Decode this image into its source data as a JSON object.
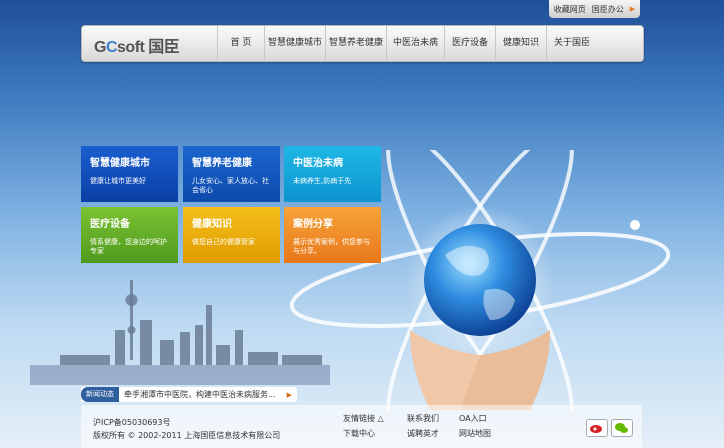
{
  "topbar": {
    "items": [
      "收藏网页",
      "国臣办公"
    ]
  },
  "nav": {
    "logo_prefix": "G",
    "logo_c": "C",
    "logo_suffix": "soft 国臣",
    "items": [
      "首 页",
      "智慧健康城市",
      "智慧养老健康",
      "中医治未病",
      "医疗设备",
      "健康知识",
      "关于国臣"
    ]
  },
  "tiles": [
    {
      "title": "智慧健康城市",
      "desc": "健康让城市更美好"
    },
    {
      "title": "智慧养老健康",
      "desc": "儿女安心、家人放心、社会省心"
    },
    {
      "title": "中医治未病",
      "desc": "未病养生,防病于先"
    },
    {
      "title": "医疗设备",
      "desc": "情系健康，您身边的呵护专家"
    },
    {
      "title": "健康知识",
      "desc": "做您自己的健康管家"
    },
    {
      "title": "案例分享",
      "desc": "展示优秀案例，供您参与与分享。"
    }
  ],
  "news": {
    "label": "新闻动态",
    "text": "牵手湘潭市中医院，构建中医治未病服务..."
  },
  "footer": {
    "icp": "沪ICP备05030693号",
    "copyright": "版权所有 © 2002-2011 上海国臣信息技术有限公司",
    "links": [
      "友情链接 △",
      "联系我们",
      "OA入口",
      "下载中心",
      "诚聘英才",
      "网站地图"
    ]
  },
  "colors": {
    "brand_blue": "#2f5f9e",
    "accent_orange": "#e08020"
  }
}
